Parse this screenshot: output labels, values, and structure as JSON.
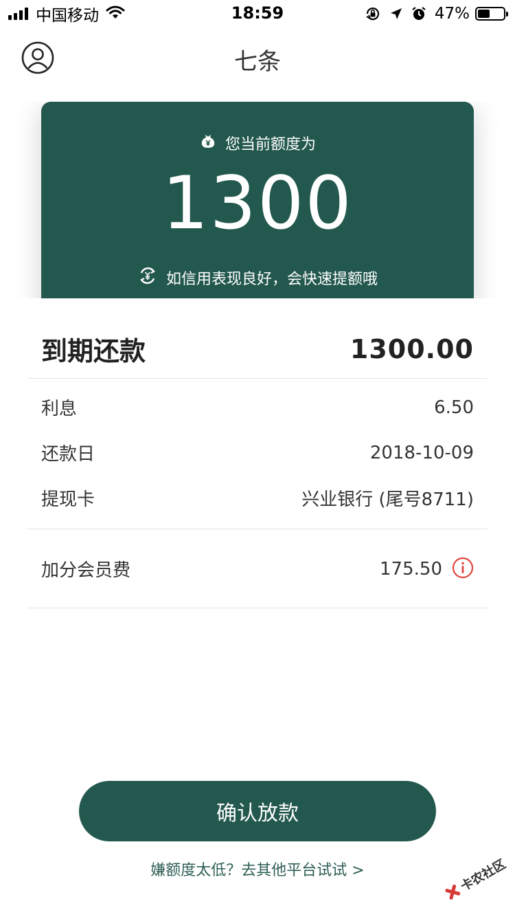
{
  "status_bar": {
    "carrier": "中国移动",
    "time": "18:59",
    "battery": "47%",
    "battery_level": 0.47,
    "icons": [
      "signal-icon",
      "wifi-icon",
      "orientation-lock-icon",
      "location-icon",
      "alarm-icon",
      "battery-icon"
    ]
  },
  "nav": {
    "title": "七条",
    "avatar_icon": "user-icon"
  },
  "card": {
    "label": "您当前额度为",
    "amount": "1300",
    "tip": "如信用表现良好，会快速提额哦",
    "background_color": "#23584e"
  },
  "details": {
    "due": {
      "label": "到期还款",
      "value": "1300.00"
    },
    "items": [
      {
        "label": "利息",
        "value": "6.50"
      },
      {
        "label": "还款日",
        "value": "2018-10-09"
      },
      {
        "label": "提现卡",
        "value": "兴业银行 (尾号8711)"
      }
    ],
    "membership": {
      "label": "加分会员费",
      "value": "175.50",
      "icon": "info-icon",
      "icon_color": "#e0473f"
    }
  },
  "actions": {
    "confirm": "确认放款",
    "other_platforms": "嫌额度太低？去其他平台试试 >"
  },
  "watermark": {
    "text": "卡农社区"
  }
}
